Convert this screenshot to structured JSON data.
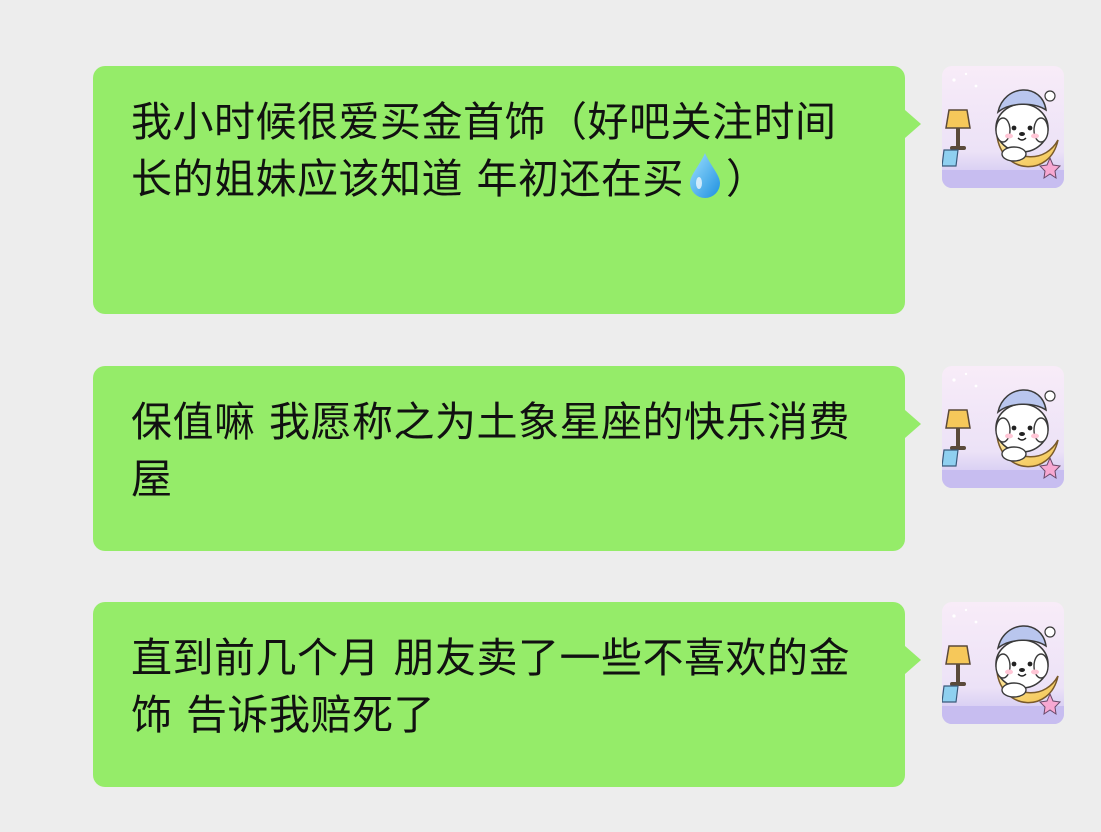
{
  "messages": [
    {
      "text_before": "我小时候很爱买金首饰（好吧关注时间长的姐妹应该知道 年初还在买",
      "emoji": "droplet",
      "text_after": "）"
    },
    {
      "text_before": "保值嘛 我愿称之为土象星座的快乐消费屋",
      "text_after": ""
    },
    {
      "text_before": "直到前几个月 朋友卖了一些不喜欢的金饰 告诉我赔死了",
      "text_after": ""
    }
  ],
  "avatar": {
    "icon": "sleeping-dog-on-moon-avatar"
  },
  "colors": {
    "background": "#ededed",
    "bubble": "#95ec69",
    "text": "#111111",
    "avatar_bg_top": "#f6e6f7",
    "avatar_bg_bottom": "#cfc6f2"
  }
}
